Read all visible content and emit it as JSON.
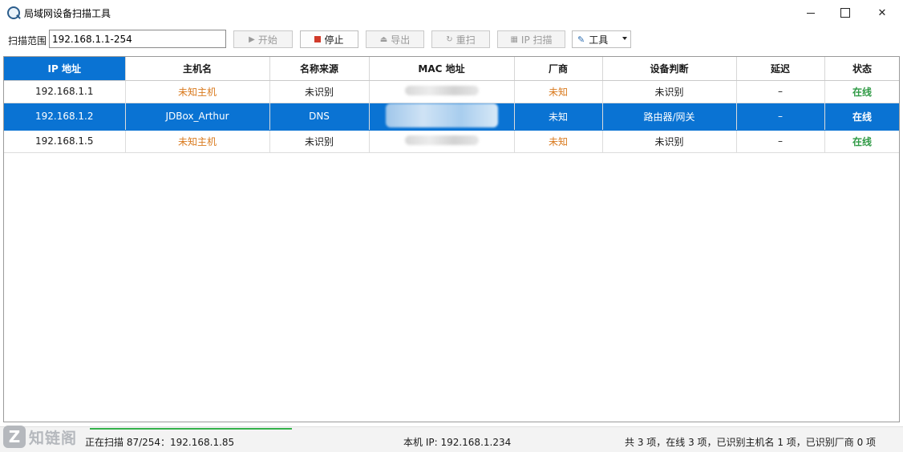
{
  "window": {
    "title": "局域网设备扫描工具",
    "close_glyph": "✕"
  },
  "toolbar": {
    "range_label": "扫描范围",
    "range_value": "192.168.1.1-254",
    "start_label": "开始",
    "stop_label": "停止",
    "export_label": "导出",
    "rescan_label": "重扫",
    "ip_scan_label": "IP 扫描",
    "tools_label": "工具"
  },
  "table": {
    "columns": [
      "IP 地址",
      "主机名",
      "名称来源",
      "MAC 地址",
      "厂商",
      "设备判断",
      "延迟",
      "状态"
    ],
    "rows": [
      {
        "ip": "192.168.1.1",
        "hostname": "未知主机",
        "source": "未识别",
        "vendor": "未知",
        "device": "未识别",
        "latency": "–",
        "status": "在线",
        "selected": false
      },
      {
        "ip": "192.168.1.2",
        "hostname": "JDBox_Arthur",
        "source": "DNS",
        "vendor": "未知",
        "device": "路由器/网关",
        "latency": "–",
        "status": "在线",
        "selected": true
      },
      {
        "ip": "192.168.1.5",
        "hostname": "未知主机",
        "source": "未识别",
        "vendor": "未知",
        "device": "未识别",
        "latency": "–",
        "status": "在线",
        "selected": false
      }
    ]
  },
  "statusbar": {
    "scan_progress_text": "正在扫描 87/254：192.168.1.85",
    "progress_fraction": 0.3425,
    "local_ip": "本机 IP: 192.168.1.234",
    "summary": "共 3 项，在线 3 项，已识别主机名 1 项，已识别厂商 0 项"
  },
  "watermark": {
    "letter": "Z",
    "text": "知链阁"
  },
  "colors": {
    "accent": "#0a73d3",
    "unknown": "#d97a1e",
    "online": "#2f9a45",
    "stop": "#d13b2b"
  },
  "icons": [
    "app-logo-icon",
    "play-icon",
    "stop-icon",
    "export-icon",
    "refresh-icon",
    "grid-icon",
    "wrench-icon",
    "chevron-down-icon"
  ]
}
